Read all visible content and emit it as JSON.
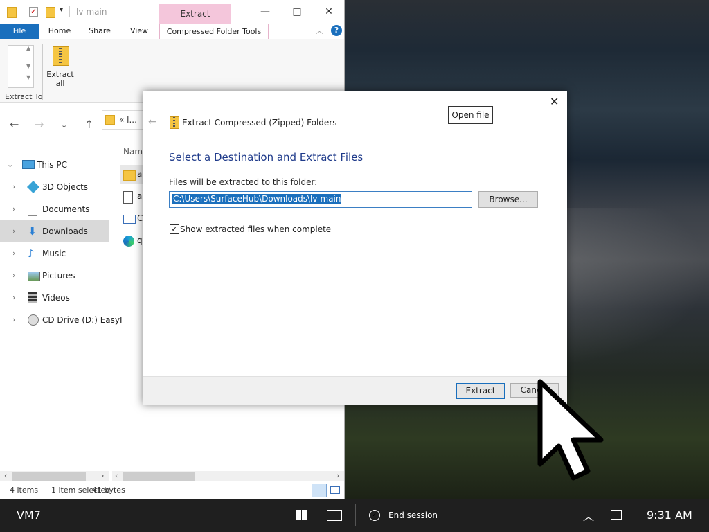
{
  "explorer": {
    "window_title": "lv-main",
    "context_tab": "Extract",
    "ribbon_tabs": {
      "file": "File",
      "home": "Home",
      "share": "Share",
      "view": "View",
      "tools": "Compressed Folder Tools"
    },
    "ribbon": {
      "extract_to": "Extract To",
      "extract_all_line1": "Extract",
      "extract_all_line2": "all"
    },
    "address_text": "« l...",
    "column_name": "Nam",
    "sidebar": [
      {
        "label": "This PC",
        "icon": "computer-icon"
      },
      {
        "label": "3D Objects",
        "icon": "cube-icon"
      },
      {
        "label": "Documents",
        "icon": "document-icon"
      },
      {
        "label": "Downloads",
        "icon": "download-icon"
      },
      {
        "label": "Music",
        "icon": "music-icon"
      },
      {
        "label": "Pictures",
        "icon": "picture-icon"
      },
      {
        "label": "Videos",
        "icon": "video-icon"
      },
      {
        "label": "CD Drive (D:) EasyI",
        "icon": "cd-drive-icon"
      }
    ],
    "files": [
      {
        "label": "a",
        "icon": "folder-icon"
      },
      {
        "label": "a",
        "icon": "script-file-icon"
      },
      {
        "label": "C",
        "icon": "window-file-icon"
      },
      {
        "label": "q",
        "icon": "edge-icon"
      }
    ],
    "status": {
      "count": "4 items",
      "selected": "1 item selected",
      "size": "41 bytes"
    }
  },
  "dialog": {
    "title": "Extract Compressed (Zipped) Folders",
    "tooltip": "Open file",
    "heading": "Select a Destination and Extract Files",
    "dest_label": "Files will be extracted to this folder:",
    "dest_value": "C:\\Users\\SurfaceHub\\Downloads\\lv-main",
    "browse": "Browse...",
    "show_files": "Show extracted files when complete",
    "extract": "Extract",
    "cancel": "Cancel"
  },
  "taskbar": {
    "vm": "VM7",
    "end_session": "End session",
    "time": "9:31 AM"
  },
  "colors": {
    "accent": "#1a6fbd",
    "context_tab": "#f4c6db"
  }
}
